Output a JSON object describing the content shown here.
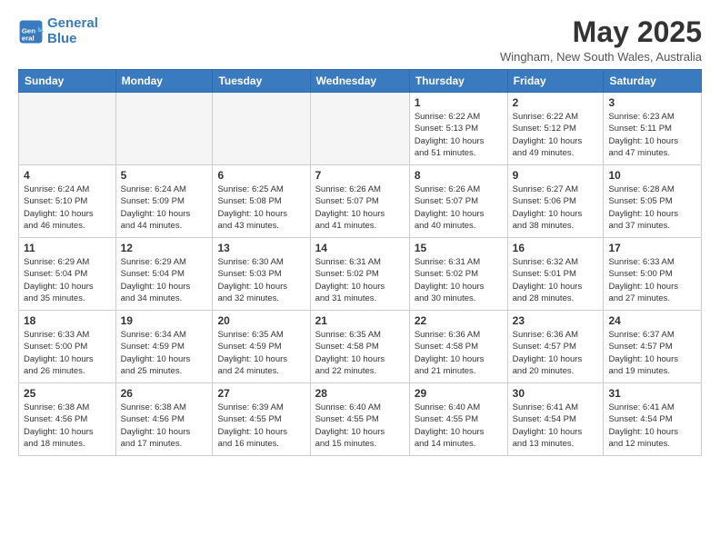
{
  "logo": {
    "line1": "General",
    "line2": "Blue"
  },
  "title": "May 2025",
  "location": "Wingham, New South Wales, Australia",
  "days_of_week": [
    "Sunday",
    "Monday",
    "Tuesday",
    "Wednesday",
    "Thursday",
    "Friday",
    "Saturday"
  ],
  "weeks": [
    [
      {
        "day": "",
        "info": ""
      },
      {
        "day": "",
        "info": ""
      },
      {
        "day": "",
        "info": ""
      },
      {
        "day": "",
        "info": ""
      },
      {
        "day": "1",
        "info": "Sunrise: 6:22 AM\nSunset: 5:13 PM\nDaylight: 10 hours\nand 51 minutes."
      },
      {
        "day": "2",
        "info": "Sunrise: 6:22 AM\nSunset: 5:12 PM\nDaylight: 10 hours\nand 49 minutes."
      },
      {
        "day": "3",
        "info": "Sunrise: 6:23 AM\nSunset: 5:11 PM\nDaylight: 10 hours\nand 47 minutes."
      }
    ],
    [
      {
        "day": "4",
        "info": "Sunrise: 6:24 AM\nSunset: 5:10 PM\nDaylight: 10 hours\nand 46 minutes."
      },
      {
        "day": "5",
        "info": "Sunrise: 6:24 AM\nSunset: 5:09 PM\nDaylight: 10 hours\nand 44 minutes."
      },
      {
        "day": "6",
        "info": "Sunrise: 6:25 AM\nSunset: 5:08 PM\nDaylight: 10 hours\nand 43 minutes."
      },
      {
        "day": "7",
        "info": "Sunrise: 6:26 AM\nSunset: 5:07 PM\nDaylight: 10 hours\nand 41 minutes."
      },
      {
        "day": "8",
        "info": "Sunrise: 6:26 AM\nSunset: 5:07 PM\nDaylight: 10 hours\nand 40 minutes."
      },
      {
        "day": "9",
        "info": "Sunrise: 6:27 AM\nSunset: 5:06 PM\nDaylight: 10 hours\nand 38 minutes."
      },
      {
        "day": "10",
        "info": "Sunrise: 6:28 AM\nSunset: 5:05 PM\nDaylight: 10 hours\nand 37 minutes."
      }
    ],
    [
      {
        "day": "11",
        "info": "Sunrise: 6:29 AM\nSunset: 5:04 PM\nDaylight: 10 hours\nand 35 minutes."
      },
      {
        "day": "12",
        "info": "Sunrise: 6:29 AM\nSunset: 5:04 PM\nDaylight: 10 hours\nand 34 minutes."
      },
      {
        "day": "13",
        "info": "Sunrise: 6:30 AM\nSunset: 5:03 PM\nDaylight: 10 hours\nand 32 minutes."
      },
      {
        "day": "14",
        "info": "Sunrise: 6:31 AM\nSunset: 5:02 PM\nDaylight: 10 hours\nand 31 minutes."
      },
      {
        "day": "15",
        "info": "Sunrise: 6:31 AM\nSunset: 5:02 PM\nDaylight: 10 hours\nand 30 minutes."
      },
      {
        "day": "16",
        "info": "Sunrise: 6:32 AM\nSunset: 5:01 PM\nDaylight: 10 hours\nand 28 minutes."
      },
      {
        "day": "17",
        "info": "Sunrise: 6:33 AM\nSunset: 5:00 PM\nDaylight: 10 hours\nand 27 minutes."
      }
    ],
    [
      {
        "day": "18",
        "info": "Sunrise: 6:33 AM\nSunset: 5:00 PM\nDaylight: 10 hours\nand 26 minutes."
      },
      {
        "day": "19",
        "info": "Sunrise: 6:34 AM\nSunset: 4:59 PM\nDaylight: 10 hours\nand 25 minutes."
      },
      {
        "day": "20",
        "info": "Sunrise: 6:35 AM\nSunset: 4:59 PM\nDaylight: 10 hours\nand 24 minutes."
      },
      {
        "day": "21",
        "info": "Sunrise: 6:35 AM\nSunset: 4:58 PM\nDaylight: 10 hours\nand 22 minutes."
      },
      {
        "day": "22",
        "info": "Sunrise: 6:36 AM\nSunset: 4:58 PM\nDaylight: 10 hours\nand 21 minutes."
      },
      {
        "day": "23",
        "info": "Sunrise: 6:36 AM\nSunset: 4:57 PM\nDaylight: 10 hours\nand 20 minutes."
      },
      {
        "day": "24",
        "info": "Sunrise: 6:37 AM\nSunset: 4:57 PM\nDaylight: 10 hours\nand 19 minutes."
      }
    ],
    [
      {
        "day": "25",
        "info": "Sunrise: 6:38 AM\nSunset: 4:56 PM\nDaylight: 10 hours\nand 18 minutes."
      },
      {
        "day": "26",
        "info": "Sunrise: 6:38 AM\nSunset: 4:56 PM\nDaylight: 10 hours\nand 17 minutes."
      },
      {
        "day": "27",
        "info": "Sunrise: 6:39 AM\nSunset: 4:55 PM\nDaylight: 10 hours\nand 16 minutes."
      },
      {
        "day": "28",
        "info": "Sunrise: 6:40 AM\nSunset: 4:55 PM\nDaylight: 10 hours\nand 15 minutes."
      },
      {
        "day": "29",
        "info": "Sunrise: 6:40 AM\nSunset: 4:55 PM\nDaylight: 10 hours\nand 14 minutes."
      },
      {
        "day": "30",
        "info": "Sunrise: 6:41 AM\nSunset: 4:54 PM\nDaylight: 10 hours\nand 13 minutes."
      },
      {
        "day": "31",
        "info": "Sunrise: 6:41 AM\nSunset: 4:54 PM\nDaylight: 10 hours\nand 12 minutes."
      }
    ]
  ]
}
